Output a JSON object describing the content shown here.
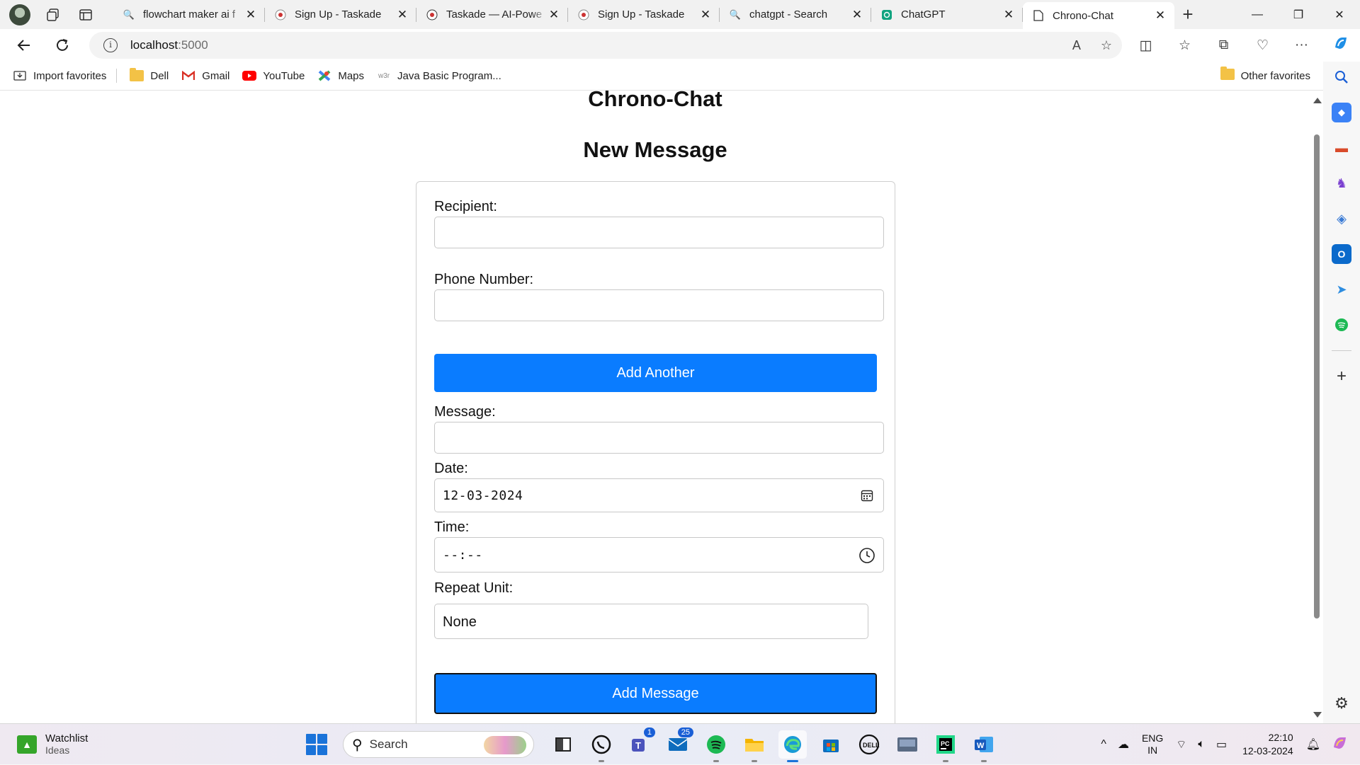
{
  "browser": {
    "tabs": [
      {
        "title": "flowchart maker ai f",
        "favicon": "search-icon",
        "active": false
      },
      {
        "title": "Sign Up - Taskade",
        "favicon": "taskade-icon",
        "active": false
      },
      {
        "title": "Taskade — AI-Powe",
        "favicon": "taskade-icon",
        "active": false
      },
      {
        "title": "Sign Up - Taskade",
        "favicon": "taskade-icon",
        "active": false
      },
      {
        "title": "chatgpt - Search",
        "favicon": "search-icon",
        "active": false
      },
      {
        "title": "ChatGPT",
        "favicon": "chatgpt-icon",
        "active": false
      },
      {
        "title": "Chrono-Chat",
        "favicon": "page-icon",
        "active": true
      }
    ],
    "address": {
      "host": "localhost",
      "port": ":5000"
    },
    "favorites": [
      {
        "label": "Import favorites",
        "icon": "import-icon"
      },
      {
        "label": "Dell",
        "icon": "folder-icon"
      },
      {
        "label": "Gmail",
        "icon": "gmail-icon"
      },
      {
        "label": "YouTube",
        "icon": "youtube-icon"
      },
      {
        "label": "Maps",
        "icon": "maps-icon"
      },
      {
        "label": "Java Basic Program...",
        "icon": "w3r-icon",
        "icon_text": "w3r"
      }
    ],
    "other_favorites": "Other favorites"
  },
  "page": {
    "app_title": "Chrono-Chat",
    "heading": "New Message",
    "form": {
      "recipient_label": "Recipient:",
      "recipient_value": "",
      "phone_label": "Phone Number:",
      "phone_value": "",
      "add_another": "Add Another",
      "message_label": "Message:",
      "message_value": "",
      "date_label": "Date:",
      "date_value": "12-03-2024",
      "time_label": "Time:",
      "time_value": "--:--",
      "repeat_label": "Repeat Unit:",
      "repeat_value": "None",
      "submit": "Add Message"
    }
  },
  "taskbar": {
    "widget": {
      "title": "Watchlist",
      "subtitle": "Ideas"
    },
    "search_placeholder": "Search",
    "apps": [
      {
        "name": "terminal-app",
        "label": "",
        "badge": ""
      },
      {
        "name": "whatsapp-app",
        "label": "",
        "badge": ""
      },
      {
        "name": "teams-app",
        "label": "T",
        "badge": "1"
      },
      {
        "name": "mail-app",
        "label": "",
        "badge": "25"
      },
      {
        "name": "spotify-app",
        "label": "",
        "badge": ""
      },
      {
        "name": "file-explorer-app",
        "label": "",
        "badge": ""
      },
      {
        "name": "edge-app",
        "label": "",
        "badge": ""
      },
      {
        "name": "store-app",
        "label": "",
        "badge": ""
      },
      {
        "name": "dell-app",
        "label": "DELL",
        "badge": ""
      },
      {
        "name": "dell-app-2",
        "label": "",
        "badge": ""
      },
      {
        "name": "pycharm-app",
        "label": "PC",
        "badge": ""
      },
      {
        "name": "word-app",
        "label": "W",
        "badge": ""
      }
    ],
    "lang_top": "ENG",
    "lang_bottom": "IN",
    "time": "22:10",
    "date": "12-03-2024"
  },
  "colors": {
    "accent": "#0a7cff",
    "edge_blue": "#1a73d9"
  }
}
